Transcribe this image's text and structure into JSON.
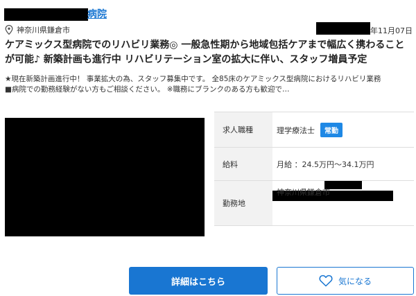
{
  "header": {
    "hospital_suffix": "病院",
    "location": "神奈川県鎌倉市",
    "date": "年11月07日",
    "icons": {
      "location": "map-pin-icon"
    }
  },
  "job": {
    "title": "ケアミックス型病院でのリハビリ業務◎ 一般急性期から地域包括ケアまで幅広く携わることが可能♪ 新築計画も進行中 リハビリテーション室の拡大に伴い、スタッフ増員予定",
    "summary_line1": "★現在新築計画進行中！ 事業拡大の為、スタッフ募集中です。 全85床のケアミックス型病院におけるリハビリ業務",
    "summary_line2": "■病院での勤務経験がない方もご相談ください。 ※職務にブランクのある方も歓迎で…"
  },
  "details": {
    "occupation_label": "求人職種",
    "occupation_value": "理学療法士",
    "employment_badge": "常勤",
    "salary_label": "給料",
    "salary_value": "月給 ：24.5万円〜34.1万円",
    "workplace_label": "勤務地",
    "workplace_value": "神奈川県鎌倉市"
  },
  "actions": {
    "details_button": "詳細はこちら",
    "favorite_button": "気になる",
    "icons": {
      "favorite": "heart-icon"
    }
  },
  "colors": {
    "accent": "#1976d2",
    "badge": "#1e88e5",
    "table_header_bg": "#f2f2f2",
    "redaction": "#000000"
  }
}
